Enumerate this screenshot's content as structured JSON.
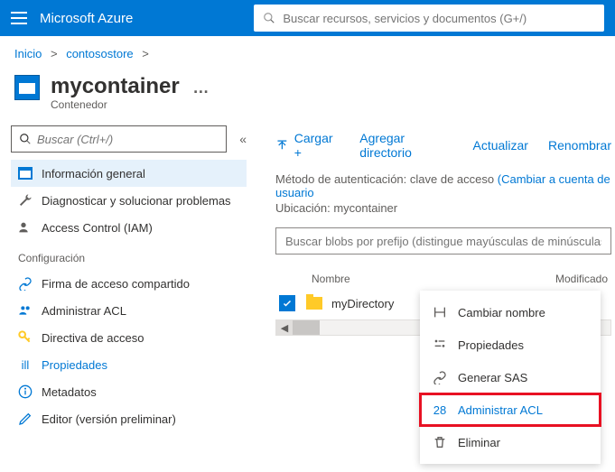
{
  "topbar": {
    "brand": "Microsoft Azure",
    "search_placeholder": "Buscar recursos, servicios y documentos (G+/)"
  },
  "breadcrumb": {
    "home": "Inicio",
    "store": "contosostore"
  },
  "page": {
    "title": "mycontainer",
    "subtitle": "Contenedor"
  },
  "sidebar": {
    "search_placeholder": "Buscar (Ctrl+/)",
    "items": {
      "overview": "Información general",
      "diagnose": "Diagnosticar y solucionar problemas",
      "iam": "Access Control (IAM)"
    },
    "section_config": "Configuración",
    "config_items": {
      "sas": "Firma de acceso compartido",
      "acl": "Administrar ACL",
      "policy": "Directiva de acceso",
      "props": "Propiedades",
      "meta": "Metadatos",
      "editor": "Editor (versión preliminar)"
    }
  },
  "cmdbar": {
    "upload": "Cargar +",
    "add_dir": "Agregar directorio",
    "refresh": "Actualizar",
    "rename": "Renombrar"
  },
  "info": {
    "auth_label": "Método de autenticación: ",
    "auth_value": "clave de acceso",
    "auth_switch": "(Cambiar a cuenta de usuario",
    "location_label": "Ubicación: ",
    "location_value": "mycontainer"
  },
  "blobsearch": {
    "placeholder": "Buscar blobs por prefijo (distingue mayúsculas de minúsculas)"
  },
  "table": {
    "col_name": "Nombre",
    "col_modified": "Modificado",
    "rows": [
      {
        "name": "myDirectory"
      }
    ]
  },
  "context": {
    "rename": "Cambiar nombre",
    "props": "Propiedades",
    "sas": "Generar SAS",
    "acl_prefix": "28 ",
    "acl": "Administrar ACL",
    "delete": "Eliminar"
  }
}
